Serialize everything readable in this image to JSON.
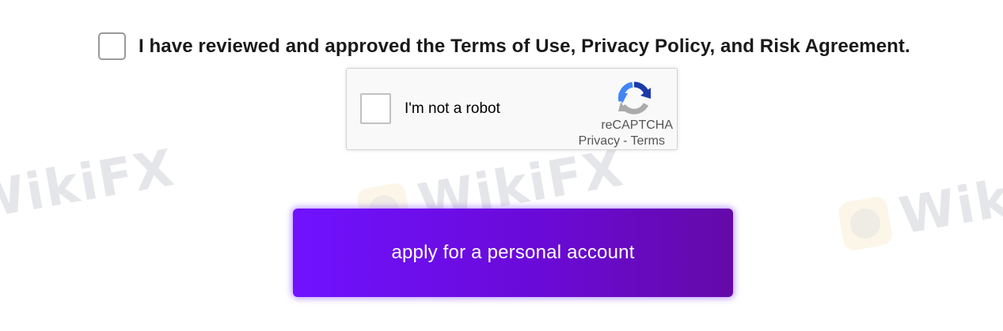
{
  "watermark": {
    "text": "WikiFX"
  },
  "agreement": {
    "text": "I have reviewed and approved the Terms of Use, Privacy Policy, and Risk Agreement.",
    "checked": false
  },
  "recaptcha": {
    "label": "I'm not a robot",
    "brand": "reCAPTCHA",
    "privacy_link": "Privacy",
    "separator": "-",
    "terms_link": "Terms",
    "checked": false
  },
  "apply_button": {
    "label": "apply for a personal account"
  },
  "colors": {
    "button_gradient_start": "#7012ff",
    "button_gradient_end": "#640aa8",
    "recaptcha_blue": "#1c3aa9",
    "recaptcha_lightblue": "#4285f4",
    "recaptcha_gray": "#ababab"
  }
}
